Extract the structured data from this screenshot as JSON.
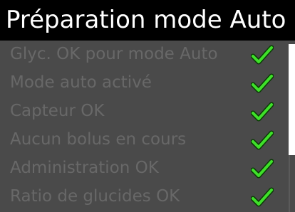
{
  "header": {
    "title": "Préparation mode Auto"
  },
  "checklist": {
    "items": [
      {
        "label": "Glyc. OK pour mode Auto",
        "status": "ok"
      },
      {
        "label": "Mode auto activé",
        "status": "ok"
      },
      {
        "label": "Capteur OK",
        "status": "ok"
      },
      {
        "label": "Aucun bolus en cours",
        "status": "ok"
      },
      {
        "label": "Administration OK",
        "status": "ok"
      },
      {
        "label": "Ratio de glucides OK",
        "status": "ok"
      }
    ]
  },
  "colors": {
    "background": "#4a4a4a",
    "header_background": "#000000",
    "header_text": "#ffffff",
    "item_text": "#686868",
    "check_fill": "#3fe02a",
    "check_outline": "#0a3a05",
    "scrollbar": "#ffffff"
  },
  "icons": {
    "status_ok": "check-icon"
  }
}
